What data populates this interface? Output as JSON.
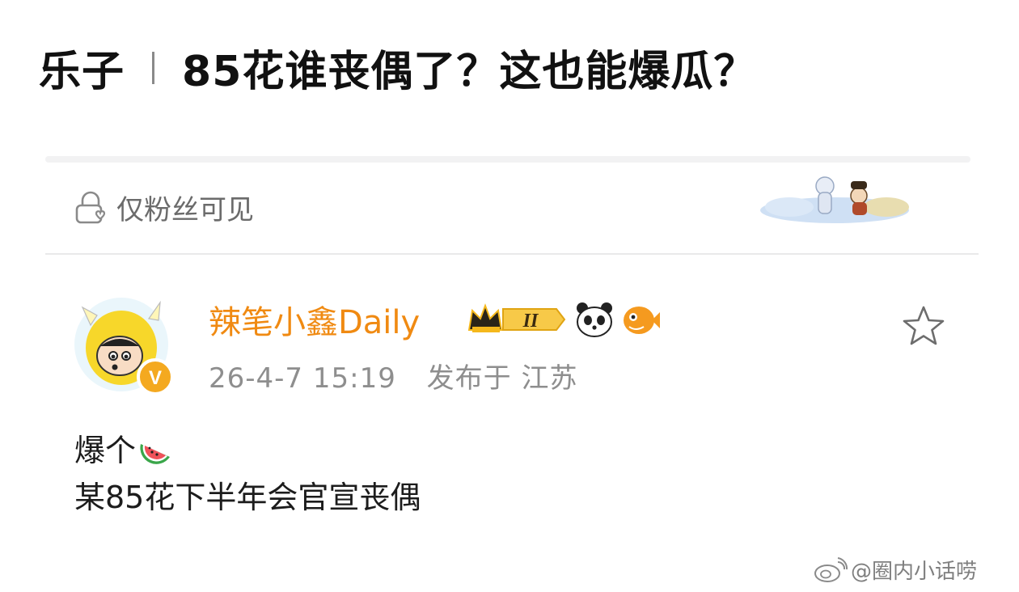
{
  "headline": {
    "category": "乐子",
    "title": "85花谁丧偶了？这也能爆瓜？"
  },
  "post": {
    "visibility_label": "仅粉丝可见",
    "visibility_icon": "lock-heart-icon",
    "author": {
      "name": "辣笔小鑫Daily",
      "verified_badge": "V",
      "level_badge": "II",
      "badge_colors": {
        "gold": "#f5b81c",
        "dark": "#3a2a10",
        "orange": "#f08a12"
      }
    },
    "timestamp": "26-4-7 15:19",
    "location_prefix": "发布于",
    "location": "江苏",
    "body_lines": [
      "爆个",
      "某85花下半年会官宣丧偶"
    ],
    "body_emoji": "watermelon-icon",
    "favorite_icon": "star-outline-icon"
  },
  "watermark": {
    "text": "@圈内小话唠"
  }
}
